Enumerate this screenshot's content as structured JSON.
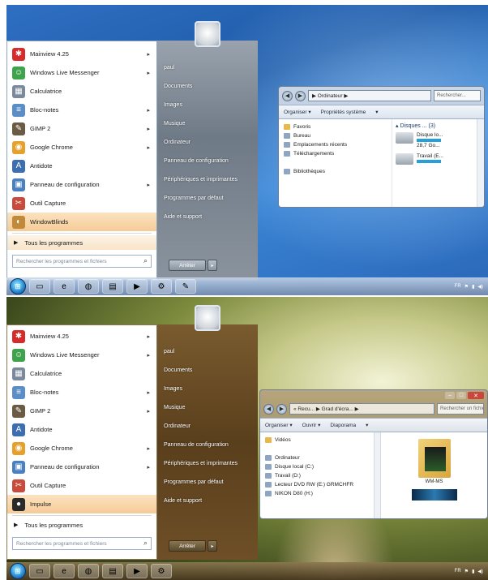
{
  "screenshot_top": {
    "start_menu": {
      "pinned_items": [
        {
          "label": "Mainview 4.25",
          "icon": "star-icon",
          "color": "#d62b2b",
          "has_arrow": true
        },
        {
          "label": "Windows Live Messenger",
          "icon": "people-icon",
          "color": "#3ea34a",
          "has_arrow": true
        },
        {
          "label": "Calculatrice",
          "icon": "calculator-icon",
          "color": "#7a8a9c",
          "has_arrow": false
        },
        {
          "label": "Bloc-notes",
          "icon": "notepad-icon",
          "color": "#5b8ec6",
          "has_arrow": true
        },
        {
          "label": "GIMP 2",
          "icon": "gimp-icon",
          "color": "#6b5a44",
          "has_arrow": true
        },
        {
          "label": "Google Chrome",
          "icon": "chrome-icon",
          "color": "#e6a02c",
          "has_arrow": true
        },
        {
          "label": "Antidote",
          "icon": "antidote-icon",
          "color": "#3c6fb0",
          "has_arrow": false
        },
        {
          "label": "Panneau de configuration",
          "icon": "control-panel-icon",
          "color": "#4a7fc0",
          "has_arrow": true
        },
        {
          "label": "Outil Capture",
          "icon": "scissors-icon",
          "color": "#c94b3b",
          "has_arrow": false
        },
        {
          "label": "WindowBlinds",
          "icon": "windowblinds-icon",
          "color": "#c08a3a",
          "has_arrow": false,
          "selected": true
        }
      ],
      "all_programs": "Tous les programmes",
      "search_placeholder": "Rechercher les programmes et fichiers",
      "right_items": [
        "paul",
        "Documents",
        "Images",
        "Musique",
        "Ordinateur",
        "Panneau de configuration",
        "Périphériques et imprimantes",
        "Programmes par défaut",
        "Aide et support"
      ],
      "shutdown_label": "Arrêter"
    },
    "explorer": {
      "address": "▶ Ordinateur ▶",
      "search_placeholder": "Rechercher...",
      "commands": [
        "Organiser ▾",
        "Propriétés système",
        "▾"
      ],
      "nav_items": [
        "Favoris",
        "Bureau",
        "Emplacements récents",
        "Téléchargements",
        "",
        "Bibliothèques"
      ],
      "content_header": "Disques ... (3)",
      "drives": [
        "Disque lo...",
        "28,7 Go...",
        "Travail (E..."
      ]
    },
    "taskbar": {
      "buttons": [
        "folder-icon",
        "ie-icon",
        "firefox-icon",
        "explorer-icon",
        "media-icon",
        "tool-icon",
        "paint-icon"
      ],
      "clock": "FR"
    }
  },
  "screenshot_bottom": {
    "start_menu": {
      "pinned_items": [
        {
          "label": "Mainview 4.25",
          "icon": "star-icon",
          "color": "#d62b2b",
          "has_arrow": true
        },
        {
          "label": "Windows Live Messenger",
          "icon": "people-icon",
          "color": "#3ea34a",
          "has_arrow": true
        },
        {
          "label": "Calculatrice",
          "icon": "calculator-icon",
          "color": "#7a8a9c",
          "has_arrow": false
        },
        {
          "label": "Bloc-notes",
          "icon": "notepad-icon",
          "color": "#5b8ec6",
          "has_arrow": true
        },
        {
          "label": "GIMP 2",
          "icon": "gimp-icon",
          "color": "#6b5a44",
          "has_arrow": true
        },
        {
          "label": "Antidote",
          "icon": "antidote-icon",
          "color": "#3c6fb0",
          "has_arrow": false
        },
        {
          "label": "Google Chrome",
          "icon": "chrome-icon",
          "color": "#e6a02c",
          "has_arrow": true
        },
        {
          "label": "Panneau de configuration",
          "icon": "control-panel-icon",
          "color": "#4a7fc0",
          "has_arrow": true
        },
        {
          "label": "Outil Capture",
          "icon": "scissors-icon",
          "color": "#c94b3b",
          "has_arrow": false
        },
        {
          "label": "Impulse",
          "icon": "impulse-icon",
          "color": "#2a2a2a",
          "has_arrow": false,
          "selected": true
        }
      ],
      "all_programs": "Tous les programmes",
      "search_placeholder": "Rechercher les programmes et fichiers",
      "right_items": [
        "paul",
        "Documents",
        "Images",
        "Musique",
        "Ordinateur",
        "Panneau de configuration",
        "Périphériques et imprimantes",
        "Programmes par défaut",
        "Aide et support"
      ],
      "shutdown_label": "Arrêter"
    },
    "explorer": {
      "address": "« Recu... ▶ Grad d'écra... ▶",
      "search_placeholder": "Rechercher un fichier",
      "commands": [
        "Organiser ▾",
        "Ouvrir ▾",
        "Diaporama",
        "▾"
      ],
      "nav_items": [
        "Vidéos",
        "",
        "Ordinateur",
        "Disque local (C:)",
        "Travail (D:)",
        "Lecteur DVD RW (E:) GRMCHFR",
        "NIKON D80 (H:)"
      ],
      "thumb_label": "WM-MS"
    },
    "taskbar": {
      "buttons": [
        "folder-icon",
        "ie-icon",
        "firefox-icon",
        "explorer-icon",
        "media-icon",
        "tool-icon"
      ],
      "clock": "FR"
    }
  }
}
